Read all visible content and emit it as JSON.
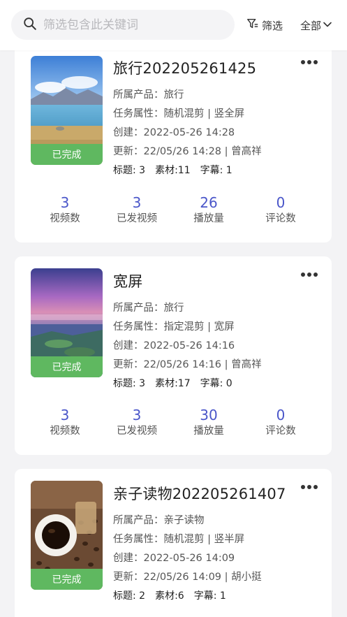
{
  "search": {
    "placeholder": "筛选包含此关键词"
  },
  "header": {
    "filter_label": "筛选",
    "all_label": "全部"
  },
  "colors": {
    "accent": "#4a56c9",
    "status_green": "#5fb860",
    "background": "#f3f3f5"
  },
  "tasks": [
    {
      "title": "旅行202205261425",
      "status": "已完成",
      "thumbnail": "lake-mountain-landscape",
      "product_line": "所属产品：旅行",
      "attribute_line": "任务属性：随机混剪 | 竖全屏",
      "created_line": "创建：2022-05-26 14:28",
      "updated_line": "更新：22/05/26 14:28 | 曾高祥",
      "titles_count": "标题: 3",
      "materials_count": "素材:11",
      "subtitles_count": "字幕: 1",
      "stats": [
        {
          "value": "3",
          "label": "视频数"
        },
        {
          "value": "3",
          "label": "已发视频"
        },
        {
          "value": "26",
          "label": "播放量"
        },
        {
          "value": "0",
          "label": "评论数"
        }
      ]
    },
    {
      "title": "宽屏",
      "status": "已完成",
      "thumbnail": "purple-sunset-seaside",
      "product_line": "所属产品：旅行",
      "attribute_line": "任务属性：指定混剪 | 宽屏",
      "created_line": "创建：2022-05-26 14:16",
      "updated_line": "更新：22/05/26 14:16 | 曾高祥",
      "titles_count": "标题: 3",
      "materials_count": "素材:17",
      "subtitles_count": "字幕: 0",
      "stats": [
        {
          "value": "3",
          "label": "视频数"
        },
        {
          "value": "3",
          "label": "已发视频"
        },
        {
          "value": "30",
          "label": "播放量"
        },
        {
          "value": "0",
          "label": "评论数"
        }
      ]
    },
    {
      "title": "亲子读物202205261407",
      "status": "已完成",
      "thumbnail": "coffee-cup-beans",
      "product_line": "所属产品：亲子读物",
      "attribute_line": "任务属性：随机混剪 | 竖半屏",
      "created_line": "创建：2022-05-26 14:09",
      "updated_line": "更新：22/05/26 14:09 | 胡小挺",
      "titles_count": "标题: 2",
      "materials_count": "素材:6",
      "subtitles_count": "字幕: 1"
    }
  ]
}
